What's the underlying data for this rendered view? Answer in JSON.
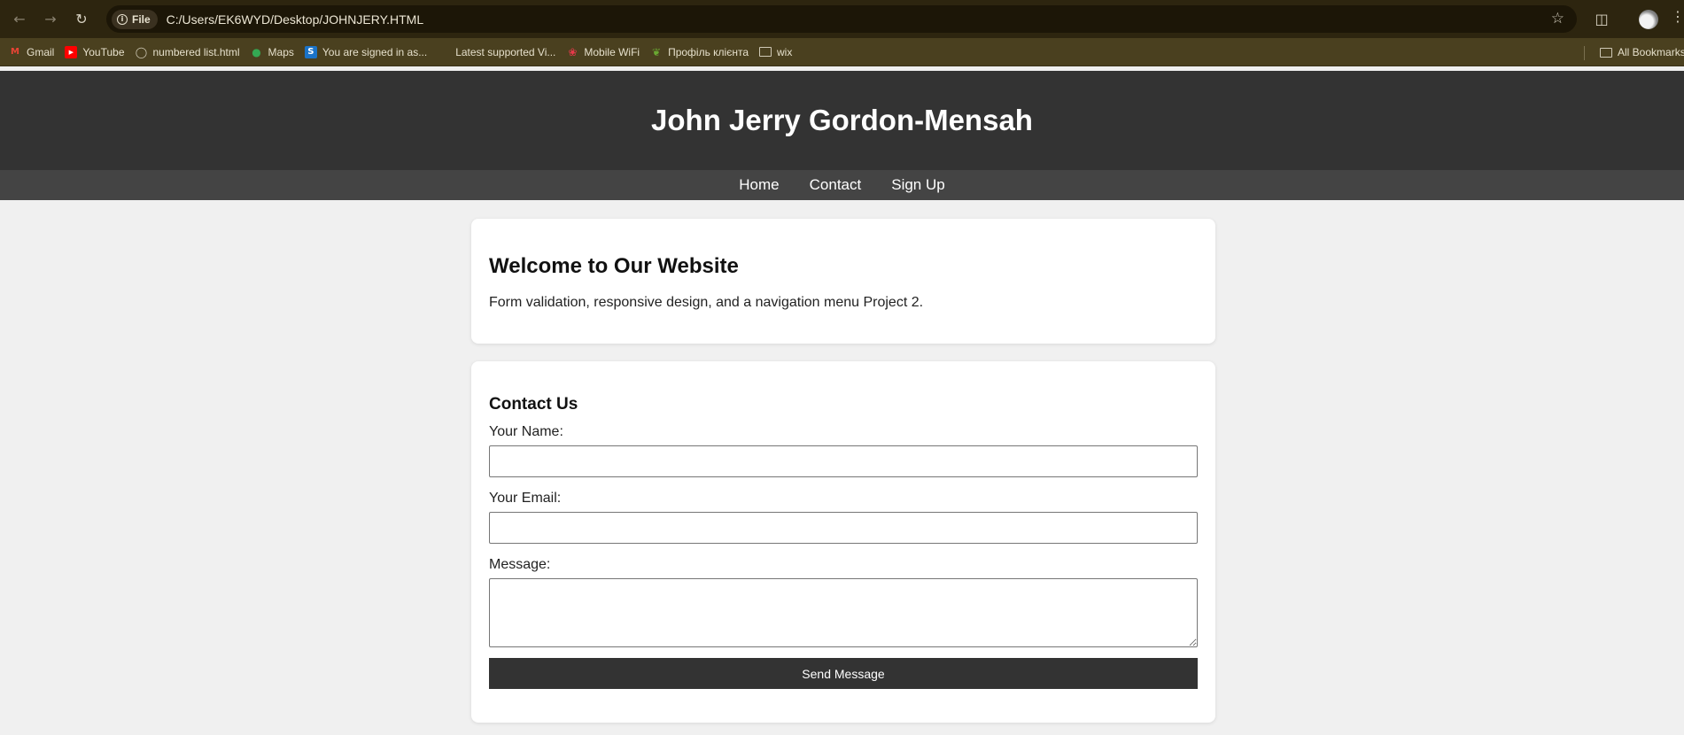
{
  "browser": {
    "site_info_label": "File",
    "url": "C:/Users/EK6WYD/Desktop/JOHNJERY.HTML",
    "bookmarks": [
      {
        "label": "Gmail",
        "icon": "gmail-icon",
        "color": "#ea4335"
      },
      {
        "label": "YouTube",
        "icon": "youtube-icon",
        "color": "#ff0000"
      },
      {
        "label": "numbered list.html",
        "icon": "globe-icon",
        "color": "#cfc9b6"
      },
      {
        "label": "Maps",
        "icon": "maps-icon",
        "color": "#34a853"
      },
      {
        "label": "You are signed in as...",
        "icon": "s-icon",
        "color": "#1a73c8"
      },
      {
        "label": "Latest supported Vi...",
        "icon": "microsoft-icon",
        "color": "#f25022"
      },
      {
        "label": "Mobile WiFi",
        "icon": "huawei-icon",
        "color": "#e8394a"
      },
      {
        "label": "Профіль клієнта",
        "icon": "leaf-icon",
        "color": "#6aa832"
      },
      {
        "label": "wix",
        "icon": "folder-icon",
        "color": "#cfc9b6"
      }
    ],
    "all_bookmarks_label": "All Bookmarks"
  },
  "site": {
    "title": "John Jerry Gordon-Mensah",
    "nav": [
      "Home",
      "Contact",
      "Sign Up"
    ]
  },
  "welcome": {
    "heading": "Welcome to Our Website",
    "text": "Form validation, responsive design, and a navigation menu Project 2."
  },
  "contact": {
    "heading": "Contact Us",
    "name_label": "Your Name:",
    "email_label": "Your Email:",
    "message_label": "Message:",
    "submit_label": "Send Message"
  }
}
